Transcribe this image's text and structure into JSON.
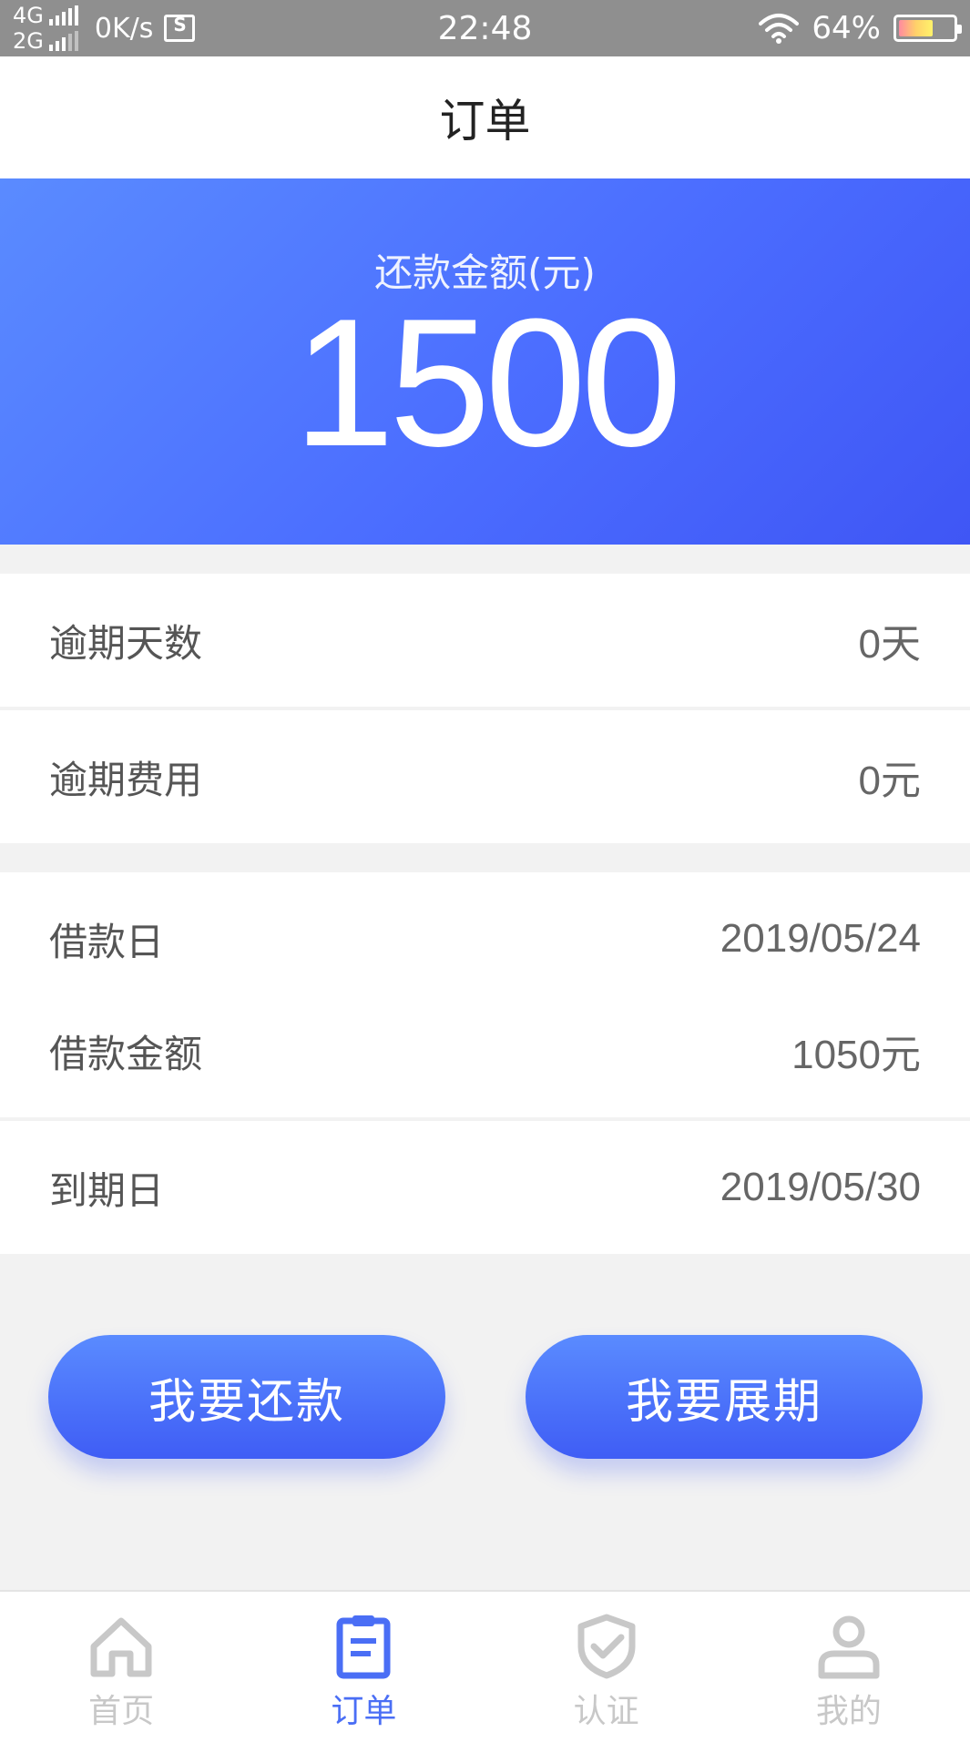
{
  "status_bar": {
    "net_top": "4G",
    "net_bottom": "2G",
    "speed": "0K/s",
    "time": "22:48",
    "battery": "64%",
    "battery_level": 0.64
  },
  "header": {
    "title": "订单"
  },
  "summary": {
    "label": "还款金额(元)",
    "amount": "1500"
  },
  "details": {
    "overdue_days": {
      "label": "逾期天数",
      "value": "0天"
    },
    "overdue_fee": {
      "label": "逾期费用",
      "value": "0元"
    },
    "loan_date": {
      "label": "借款日",
      "value": "2019/05/24"
    },
    "loan_amount": {
      "label": "借款金额",
      "value": "1050元"
    },
    "due_date": {
      "label": "到期日",
      "value": "2019/05/30"
    }
  },
  "actions": {
    "repay_label": "我要还款",
    "extend_label": "我要展期"
  },
  "tabbar": {
    "items": [
      {
        "label": "首页",
        "icon": "home-icon"
      },
      {
        "label": "订单",
        "icon": "order-icon"
      },
      {
        "label": "认证",
        "icon": "shield-check-icon"
      },
      {
        "label": "我的",
        "icon": "user-icon"
      }
    ],
    "active_index": 1
  },
  "colors": {
    "accent": "#4a6ef5",
    "hero_start": "#5a8bff",
    "hero_end": "#3f56f5",
    "inactive_tab": "#c8c8c8"
  }
}
